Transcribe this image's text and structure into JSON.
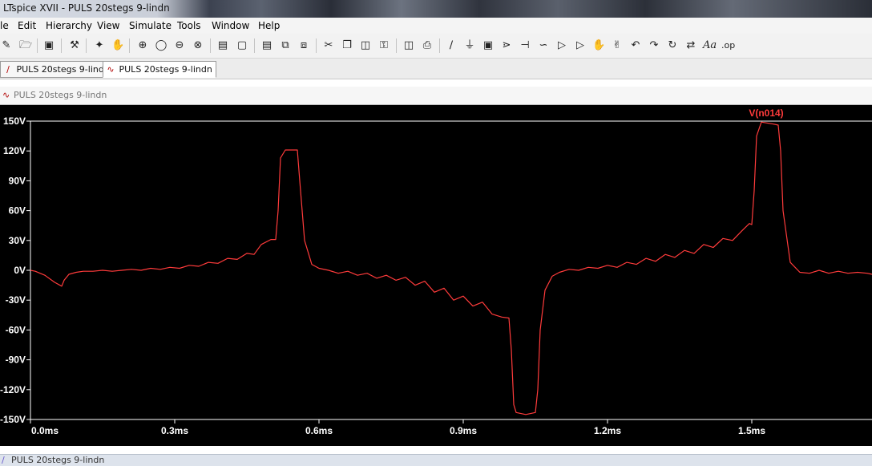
{
  "window": {
    "title": "LTspice XVII - PULS 20stegs 9-lindn"
  },
  "menu": [
    "le",
    "Edit",
    "Hierarchy",
    "View",
    "Simulate",
    "Tools",
    "Window",
    "Help"
  ],
  "toolbar": {
    "icons": [
      "new-schematic-icon",
      "open-icon",
      "save-icon",
      "control-panel-icon",
      "run-icon",
      "halt-icon",
      "zoom-in-icon",
      "pan-icon",
      "zoom-out-icon",
      "zoom-cancel-icon",
      "autorange-icon",
      "zoom-fit-icon",
      "tile-horizontal-icon",
      "cascade-icon",
      "close-window-icon",
      "cut-icon",
      "copy-icon",
      "paste-icon",
      "find-icon",
      "print-setup-icon",
      "print-icon",
      "wire-icon",
      "ground-icon",
      "label-icon",
      "resistor-icon",
      "capacitor-icon",
      "inductor-icon",
      "diode-icon",
      "component-icon",
      "move-icon",
      "drag-icon",
      "undo-icon",
      "redo-icon",
      "rotate-icon",
      "mirror-icon",
      "text-icon",
      "spice-directive-icon"
    ],
    "glyphs": {
      "text_icon": "Aa",
      "spice_directive_icon": ".op"
    }
  },
  "tabs": [
    {
      "label": "PULS 20steg 9-lindn",
      "icon": "schematic-icon",
      "active": false
    },
    {
      "label": "PULS 20stegs 9-lindn",
      "icon": "waveform-icon",
      "active": true
    }
  ],
  "tabs_labels": {
    "first": "PULS 20stegs 9-lindn",
    "second": "PULS 20stegs 9-lindn"
  },
  "waveform_window": {
    "title": "PULS 20stegs 9-lindn"
  },
  "bottom_window": {
    "title": "PULS 20stegs 9-lindn"
  },
  "colors": {
    "trace": "#ff3b3b",
    "trace_label": "#ff3b3b",
    "axis_text": "#ffffff",
    "plot_bg": "#000000",
    "grid_line": "#ffffff"
  },
  "chart_data": {
    "type": "line",
    "title": "",
    "xlabel": "",
    "ylabel": "",
    "xlim": [
      0,
      1.75
    ],
    "ylim": [
      -150,
      150
    ],
    "x_ticks": [
      "0.0ms",
      "0.3ms",
      "0.6ms",
      "0.9ms",
      "1.2ms",
      "1.5ms"
    ],
    "x_tick_values": [
      0.0,
      0.3,
      0.6,
      0.9,
      1.2,
      1.5
    ],
    "y_ticks": [
      "150V",
      "120V",
      "90V",
      "60V",
      "30V",
      "0V",
      "-30V",
      "-60V",
      "-90V",
      "-120V",
      "-150V"
    ],
    "y_tick_values": [
      150,
      120,
      90,
      60,
      30,
      0,
      -30,
      -60,
      -90,
      -120,
      -150
    ],
    "grid": false,
    "legend": "top-right",
    "series": [
      {
        "name": "V(n014)",
        "x": [
          0.0,
          0.01,
          0.03,
          0.05,
          0.065,
          0.07,
          0.08,
          0.095,
          0.11,
          0.13,
          0.15,
          0.17,
          0.19,
          0.21,
          0.23,
          0.25,
          0.27,
          0.29,
          0.31,
          0.33,
          0.35,
          0.37,
          0.39,
          0.41,
          0.43,
          0.45,
          0.465,
          0.48,
          0.5,
          0.51,
          0.515,
          0.52,
          0.53,
          0.55,
          0.555,
          0.56,
          0.57,
          0.585,
          0.6,
          0.62,
          0.64,
          0.66,
          0.68,
          0.7,
          0.72,
          0.74,
          0.76,
          0.78,
          0.8,
          0.82,
          0.84,
          0.86,
          0.88,
          0.9,
          0.92,
          0.94,
          0.96,
          0.98,
          0.995,
          1.0,
          1.005,
          1.01,
          1.03,
          1.05,
          1.055,
          1.06,
          1.07,
          1.085,
          1.1,
          1.12,
          1.14,
          1.16,
          1.18,
          1.2,
          1.22,
          1.24,
          1.26,
          1.28,
          1.3,
          1.32,
          1.34,
          1.36,
          1.38,
          1.4,
          1.42,
          1.44,
          1.46,
          1.48,
          1.495,
          1.5,
          1.505,
          1.51,
          1.52,
          1.545,
          1.555,
          1.56,
          1.565,
          1.58,
          1.6,
          1.62,
          1.64,
          1.66,
          1.68,
          1.7,
          1.72,
          1.74,
          1.76
        ],
        "y": [
          0,
          -1,
          -5,
          -12,
          -16,
          -10,
          -4,
          -2,
          -1,
          -1,
          0,
          -1,
          0,
          1,
          0,
          2,
          1,
          3,
          2,
          5,
          4,
          8,
          7,
          12,
          11,
          17,
          16,
          26,
          31,
          31,
          60,
          113,
          121,
          121,
          121,
          90,
          30,
          6,
          2,
          0,
          -3,
          -1,
          -5,
          -3,
          -8,
          -5,
          -10,
          -7,
          -15,
          -11,
          -22,
          -18,
          -30,
          -26,
          -36,
          -32,
          -44,
          -47,
          -48,
          -80,
          -135,
          -143,
          -145,
          -143,
          -120,
          -60,
          -20,
          -6,
          -2,
          1,
          0,
          3,
          2,
          5,
          3,
          8,
          6,
          12,
          9,
          16,
          13,
          20,
          17,
          26,
          23,
          32,
          30,
          40,
          47,
          46,
          80,
          135,
          149,
          147,
          146,
          120,
          60,
          8,
          -2,
          -3,
          0,
          -3,
          -1,
          -3,
          -2,
          -3,
          -4
        ]
      }
    ]
  }
}
